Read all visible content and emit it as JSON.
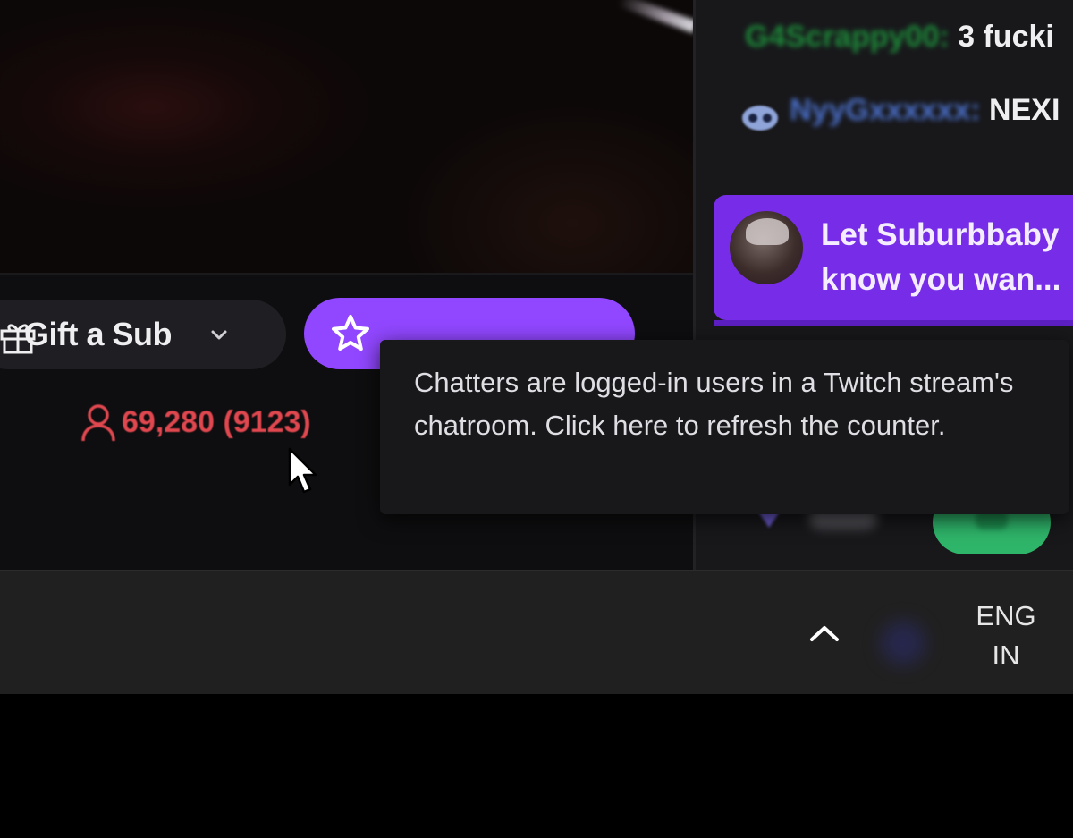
{
  "chat": {
    "messages": [
      {
        "user": "G4Scrappy00:",
        "text": " 3 fucki"
      },
      {
        "user": "NyyGxxxxxx:",
        "text": " NEXI"
      }
    ],
    "promo": {
      "line1": "Let Suburbbaby",
      "line2": "know you wan..."
    }
  },
  "stream": {
    "gift_label": "Gift a Sub",
    "viewers": "69,280 (9123)"
  },
  "tooltip": {
    "text": "Chatters are logged-in users in a Twitch stream's chatroom. Click here to refresh the counter."
  },
  "taskbar": {
    "lang_line1": "ENG",
    "lang_line2": "IN"
  },
  "colors": {
    "twitch_purple": "#9147ff",
    "viewer_red": "#e0474f",
    "send_green": "#2fb56a"
  }
}
